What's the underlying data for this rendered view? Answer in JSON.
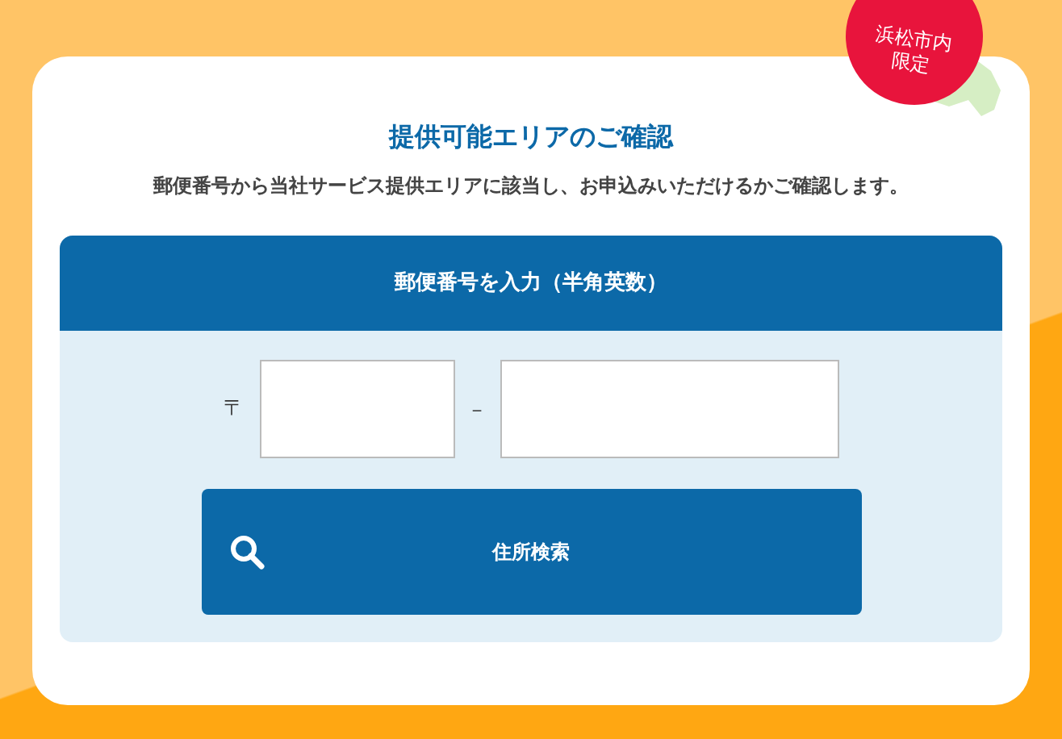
{
  "badge": {
    "lines": [
      "浜松市内",
      "限定"
    ]
  },
  "title": "提供可能エリアのご確認",
  "subtitle": "郵便番号から当社サービス提供エリアに該当し、お申込みいただけるかご確認します。",
  "form": {
    "header": "郵便番号を入力（半角英数）",
    "postal_mark": "〒",
    "separator": "－",
    "search_button": "住所検索"
  }
}
